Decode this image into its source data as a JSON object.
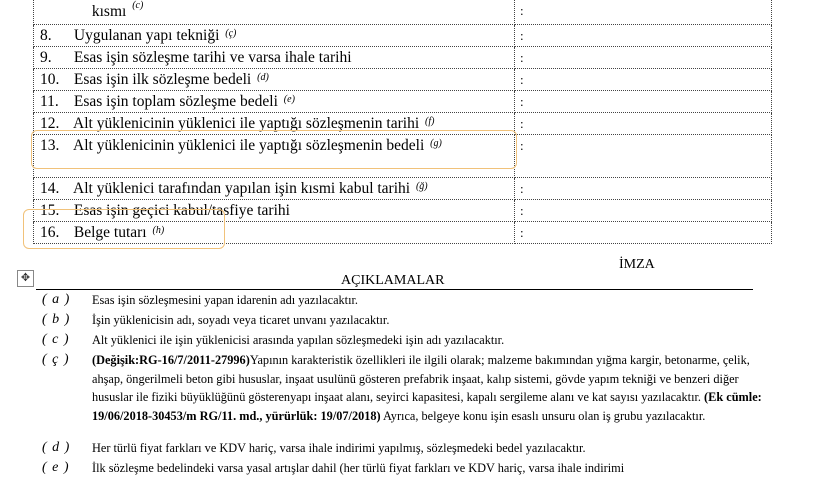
{
  "table": {
    "rows": [
      {
        "num": "",
        "label": "kısmı",
        "code": "(c)",
        "value": ":"
      },
      {
        "num": "8.",
        "label": "Uygulanan yapı tekniği",
        "code": "(ç)",
        "value": ":"
      },
      {
        "num": "9.",
        "label": "Esas işin sözleşme tarihi ve varsa ihale tarihi",
        "code": "",
        "value": ":"
      },
      {
        "num": "10.",
        "label": "Esas işin ilk sözleşme bedeli",
        "code": "(d)",
        "value": ":"
      },
      {
        "num": "11.",
        "label": "Esas işin toplam sözleşme bedeli",
        "code": "(e)",
        "value": ":"
      },
      {
        "num": "12.",
        "label": "Alt yüklenicinin yüklenici ile yaptığı  sözleşmenin tarihi",
        "code": "(f)",
        "value": ":"
      },
      {
        "num": "13.",
        "label": "Alt yüklenicinin yüklenici ile yaptığı sözleşmenin bedeli",
        "code": "(g)",
        "value": ":"
      },
      {
        "num": "14.",
        "label": "Alt yüklenici tarafından yapılan işin kısmi kabul tarihi",
        "code": "(ğ)",
        "value": ":"
      },
      {
        "num": "15.",
        "label": "Esas işin geçici kabul/tasfiye tarihi",
        "code": "",
        "value": ":"
      },
      {
        "num": "16.",
        "label": "Belge tutarı",
        "code": "(h)",
        "value": ":"
      }
    ]
  },
  "imza": "İMZA",
  "aciklamalar_title": "AÇIKLAMALAR",
  "notes": [
    {
      "label": "( a )",
      "text": "Esas işin sözleşmesini  yapan idarenin adı  yazılacaktır."
    },
    {
      "label": "( b )",
      "text": "İşin yüklenicisin adı, soyadı veya ticaret unvanı yazılacaktır."
    },
    {
      "label": "( c )",
      "text": "Alt yüklenici ile  işin yüklenicisi arasında yapılan sözleşmedeki  işin adı yazılacaktır."
    },
    {
      "label": "( ç )",
      "bold1": "(Değişik:RG-16/7/2011-27996)",
      "text1": "Yapının karakteristik özellikleri ile ilgili olarak; malzeme bakımından yığma kargir,  betonarme, çelik, ahşap, öngerilmeli beton gibi hususlar, inşaat usulünü gösteren prefabrik inşaat, kalıp sistemi, gövde yapım tekniği ve benzeri diğer hususlar ile fiziki büyüklüğünü gösterenyapı inşaat alanı, seyirci kapasitesi, kapalı sergileme alanı ve kat sayısı yazılacaktır. ",
      "bold2": "(Ek cümle: 19/06/2018-30453/m RG/11. md.,  yürürlük: 19/07/2018)",
      "text2": " Ayrıca, belgeye konu işin esaslı unsuru olan iş grubu yazılacaktır."
    },
    {
      "label": "( d )",
      "text": "Her türlü fiyat farkları ve KDV hariç, varsa ihale indirimi yapılmış, sözleşmedeki bedel  yazılacaktır."
    },
    {
      "label": "( e )",
      "text": "İlk sözleşme bedelindeki varsa yasal artışlar dahil (her türlü fiyat farkları ve KDV hariç, varsa ihale indirimi"
    }
  ],
  "move_handle_icon": "move-handle-icon",
  "highlight_color": "#f1c27a"
}
